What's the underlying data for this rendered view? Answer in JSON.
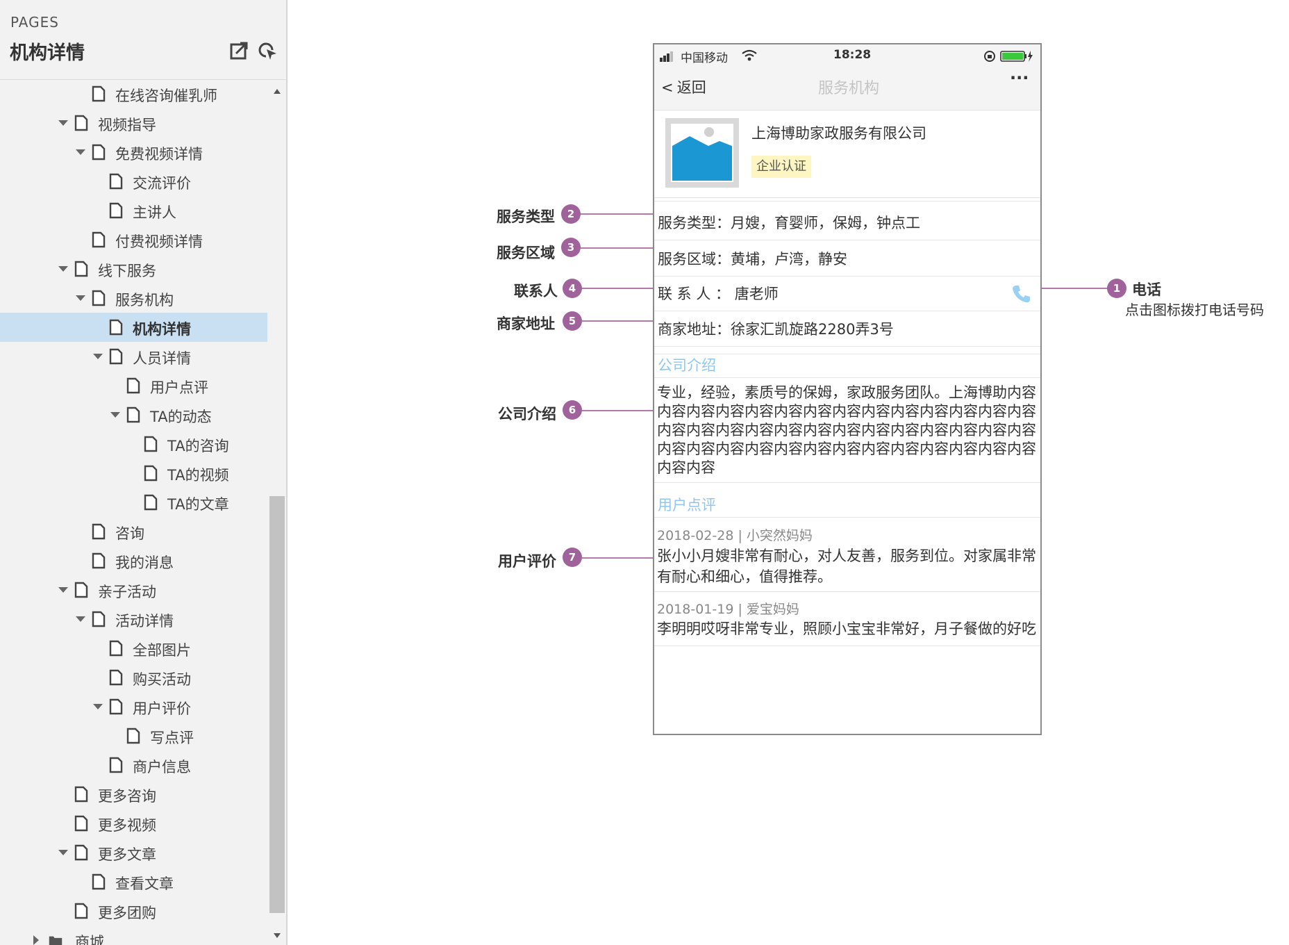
{
  "sidebar": {
    "pages_label": "PAGES",
    "title": "机构详情",
    "header_icons": [
      "export-icon",
      "pointer-icon"
    ],
    "tree": [
      {
        "label": "在线咨询催乳师",
        "level": 2,
        "type": "page",
        "arrow": "none"
      },
      {
        "label": "视频指导",
        "level": 1,
        "type": "page",
        "arrow": "expanded"
      },
      {
        "label": "免费视频详情",
        "level": 2,
        "type": "page",
        "arrow": "expanded"
      },
      {
        "label": "交流评价",
        "level": 3,
        "type": "page",
        "arrow": "none"
      },
      {
        "label": "主讲人",
        "level": 3,
        "type": "page",
        "arrow": "none"
      },
      {
        "label": "付费视频详情",
        "level": 2,
        "type": "page",
        "arrow": "none"
      },
      {
        "label": "线下服务",
        "level": 1,
        "type": "page",
        "arrow": "expanded"
      },
      {
        "label": "服务机构",
        "level": 2,
        "type": "page",
        "arrow": "expanded"
      },
      {
        "label": "机构详情",
        "level": 3,
        "type": "page",
        "arrow": "none",
        "selected": true
      },
      {
        "label": "人员详情",
        "level": 3,
        "type": "page",
        "arrow": "expanded"
      },
      {
        "label": "用户点评",
        "level": 4,
        "type": "page",
        "arrow": "none"
      },
      {
        "label": "TA的动态",
        "level": 4,
        "type": "page",
        "arrow": "expanded"
      },
      {
        "label": "TA的咨询",
        "level": 5,
        "type": "page",
        "arrow": "none"
      },
      {
        "label": "TA的视频",
        "level": 5,
        "type": "page",
        "arrow": "none"
      },
      {
        "label": "TA的文章",
        "level": 5,
        "type": "page",
        "arrow": "none"
      },
      {
        "label": "咨询",
        "level": 2,
        "type": "page",
        "arrow": "none"
      },
      {
        "label": "我的消息",
        "level": 2,
        "type": "page",
        "arrow": "none"
      },
      {
        "label": "亲子活动",
        "level": 1,
        "type": "page",
        "arrow": "expanded"
      },
      {
        "label": "活动详情",
        "level": 2,
        "type": "page",
        "arrow": "expanded"
      },
      {
        "label": "全部图片",
        "level": 3,
        "type": "page",
        "arrow": "none"
      },
      {
        "label": "购买活动",
        "level": 3,
        "type": "page",
        "arrow": "none"
      },
      {
        "label": "用户评价",
        "level": 3,
        "type": "page",
        "arrow": "expanded"
      },
      {
        "label": "写点评",
        "level": 4,
        "type": "page",
        "arrow": "none"
      },
      {
        "label": "商户信息",
        "level": 3,
        "type": "page",
        "arrow": "none"
      },
      {
        "label": "更多咨询",
        "level": 1,
        "type": "page",
        "arrow": "none"
      },
      {
        "label": "更多视频",
        "level": 1,
        "type": "page",
        "arrow": "none"
      },
      {
        "label": "更多文章",
        "level": 1,
        "type": "page",
        "arrow": "expanded"
      },
      {
        "label": "查看文章",
        "level": 2,
        "type": "page",
        "arrow": "none"
      },
      {
        "label": "更多团购",
        "level": 1,
        "type": "page",
        "arrow": "none"
      },
      {
        "label": "商城",
        "level": 0,
        "type": "folder",
        "arrow": "collapsed"
      }
    ]
  },
  "phone": {
    "status": {
      "carrier": "中国移动",
      "time": "18:28"
    },
    "nav": {
      "back": "返回",
      "title": "服务机构",
      "more": "···"
    },
    "company": {
      "name": "上海博助家政服务有限公司",
      "badge": "企业认证"
    },
    "rows": {
      "service_type": "服务类型：月嫂，育婴师，保姆，钟点工",
      "service_area": "服务区域：黄埔，卢湾，静安",
      "contact": "联 系 人 ：  唐老师",
      "address": "商家地址：徐家汇凯旋路2280弄3号"
    },
    "intro": {
      "heading": "公司介绍",
      "text": "专业，经验，素质号的保姆，家政服务团队。上海博助内容内容内容内容内容内容内容内容内容内容内容内容内容内容内容内容内容内容内容内容内容内容内容内容内容内容内容内容内容内容内容内容内容内容内容内容内容内容内容内容内容内容"
    },
    "reviews": {
      "heading": "用户点评",
      "items": [
        {
          "date": "2018-02-28",
          "user": "小突然妈妈",
          "text": "张小小月嫂非常有耐心，对人友善，服务到位。对家属非常有耐心和细心，值得推荐。"
        },
        {
          "date": "2018-01-19",
          "user": "爱宝妈妈",
          "text": "李明明哎呀非常专业，照顾小宝宝非常好，月子餐做的好吃"
        }
      ]
    }
  },
  "callouts": [
    {
      "num": "1",
      "label": "电话",
      "desc": "点击图标拨打电话号码"
    },
    {
      "num": "2",
      "label": "服务类型"
    },
    {
      "num": "3",
      "label": "服务区域"
    },
    {
      "num": "4",
      "label": "联系人"
    },
    {
      "num": "5",
      "label": "商家地址"
    },
    {
      "num": "6",
      "label": "公司介绍"
    },
    {
      "num": "7",
      "label": "用户评价"
    }
  ],
  "colors": {
    "accent_badge": "#a0629a",
    "section_head": "#8ec7ee",
    "selected_row": "#c9dff2",
    "battery": "#3cc83c",
    "enterprise_badge_bg": "#fdf6c3",
    "phone_icon": "#9ad0f2"
  }
}
